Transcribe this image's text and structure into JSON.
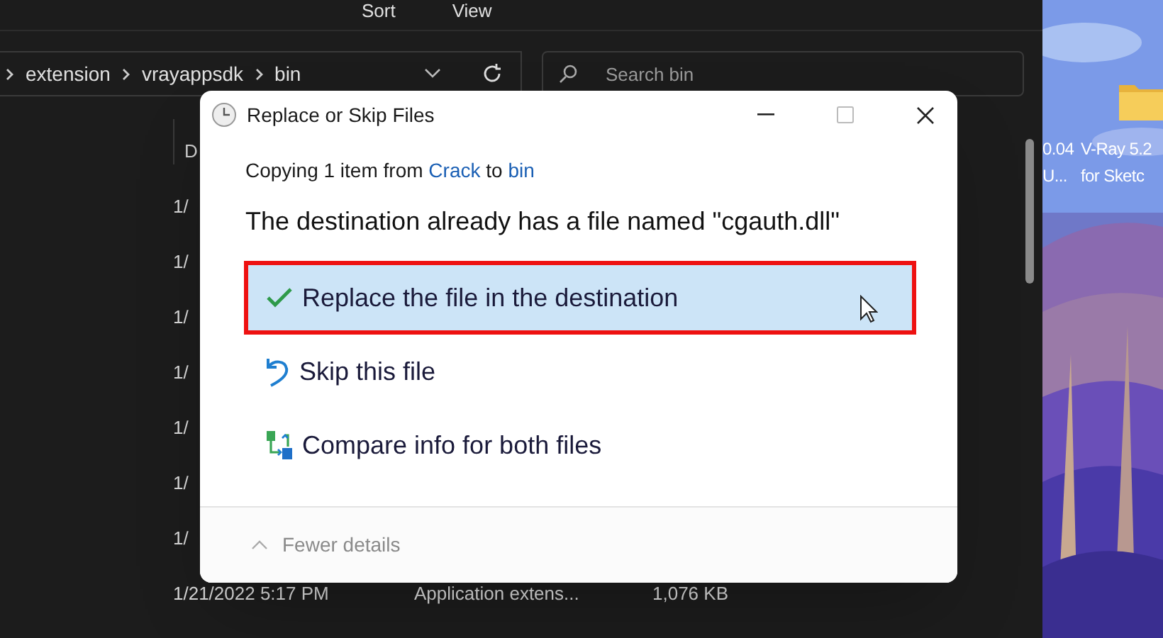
{
  "toolbar": {
    "items": [
      {
        "label": "Sort"
      },
      {
        "label": "View"
      }
    ]
  },
  "address_bar": {
    "path": [
      "extension",
      "vrayappsdk",
      "bin"
    ]
  },
  "search": {
    "placeholder": "Search bin"
  },
  "file_list": {
    "header": "D",
    "rows": [
      {
        "date": "1/"
      },
      {
        "date": "1/"
      },
      {
        "date": "1/"
      },
      {
        "date": "1/"
      },
      {
        "date": "1/"
      },
      {
        "date": "1/"
      },
      {
        "date": "1/"
      },
      {
        "date": "1/21/2022 5:17 PM",
        "type": "Application extens...",
        "size": "1,076 KB"
      }
    ]
  },
  "desktop": {
    "icons": [
      {
        "lines": [
          "0.04",
          "U..."
        ]
      },
      {
        "lines": [
          "V-Ray 5.2",
          "for Sketc"
        ]
      }
    ]
  },
  "dialog": {
    "title": "Replace or Skip Files",
    "copying": {
      "prefix": "Copying 1 item from",
      "source": "Crack",
      "joiner": "to",
      "target": "bin"
    },
    "heading": "The destination already has a file named \"cgauth.dll\"",
    "options": [
      {
        "kind": "replace",
        "label": "Replace the file in the destination",
        "selected": true,
        "annotated": true
      },
      {
        "kind": "skip",
        "label": "Skip this file",
        "selected": false,
        "annotated": false
      },
      {
        "kind": "compare",
        "label": "Compare info for both files",
        "selected": false,
        "annotated": false
      }
    ],
    "details_toggle": "Fewer details"
  }
}
